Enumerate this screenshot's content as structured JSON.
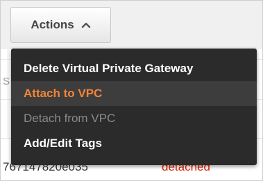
{
  "toolbar": {
    "actions_label": "Actions",
    "caret_icon": "chevron-up-icon"
  },
  "menu": {
    "items": [
      {
        "label": "Delete Virtual Private Gateway",
        "state": "enabled"
      },
      {
        "label": "Attach to VPC",
        "state": "hover"
      },
      {
        "label": "Detach from VPC",
        "state": "disabled"
      },
      {
        "label": "Add/Edit Tags",
        "state": "enabled"
      }
    ]
  },
  "table": {
    "column_fragment": "S",
    "row": {
      "id_fragment": "767147820e035",
      "state": "detached"
    }
  },
  "colors": {
    "menu_background": "#2b2b2b",
    "highlight": "#f58536",
    "disabled": "#8a8a8a",
    "state_detached": "#dd2200"
  }
}
